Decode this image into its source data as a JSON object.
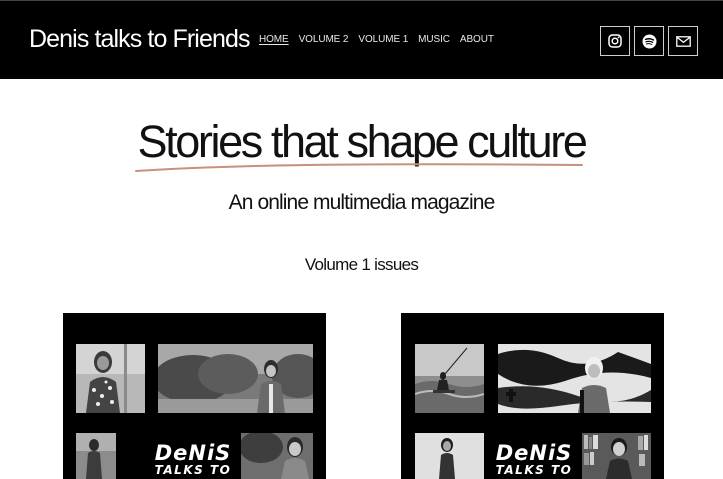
{
  "header": {
    "site_title": "Denis talks to Friends",
    "nav": [
      {
        "label": "HOME",
        "active": true
      },
      {
        "label": "VOLUME 2",
        "active": false
      },
      {
        "label": "VOLUME 1",
        "active": false
      },
      {
        "label": "MUSIC",
        "active": false
      },
      {
        "label": "ABOUT",
        "active": false
      }
    ],
    "social_icons": [
      "instagram-icon",
      "spotify-icon",
      "mail-icon"
    ]
  },
  "hero": {
    "headline": "Stories that shape culture",
    "tagline": "An online multimedia magazine"
  },
  "issues": {
    "heading": "Volume 1 issues",
    "cards": [
      {
        "logo_line1": "DeNiS",
        "logo_line2": "TALKS TO"
      },
      {
        "logo_line1": "DeNiS",
        "logo_line2": "TALKS TO"
      }
    ]
  },
  "colors": {
    "header_bg": "#000000",
    "page_bg": "#ffffff",
    "underline_accent": "#c8907f"
  }
}
